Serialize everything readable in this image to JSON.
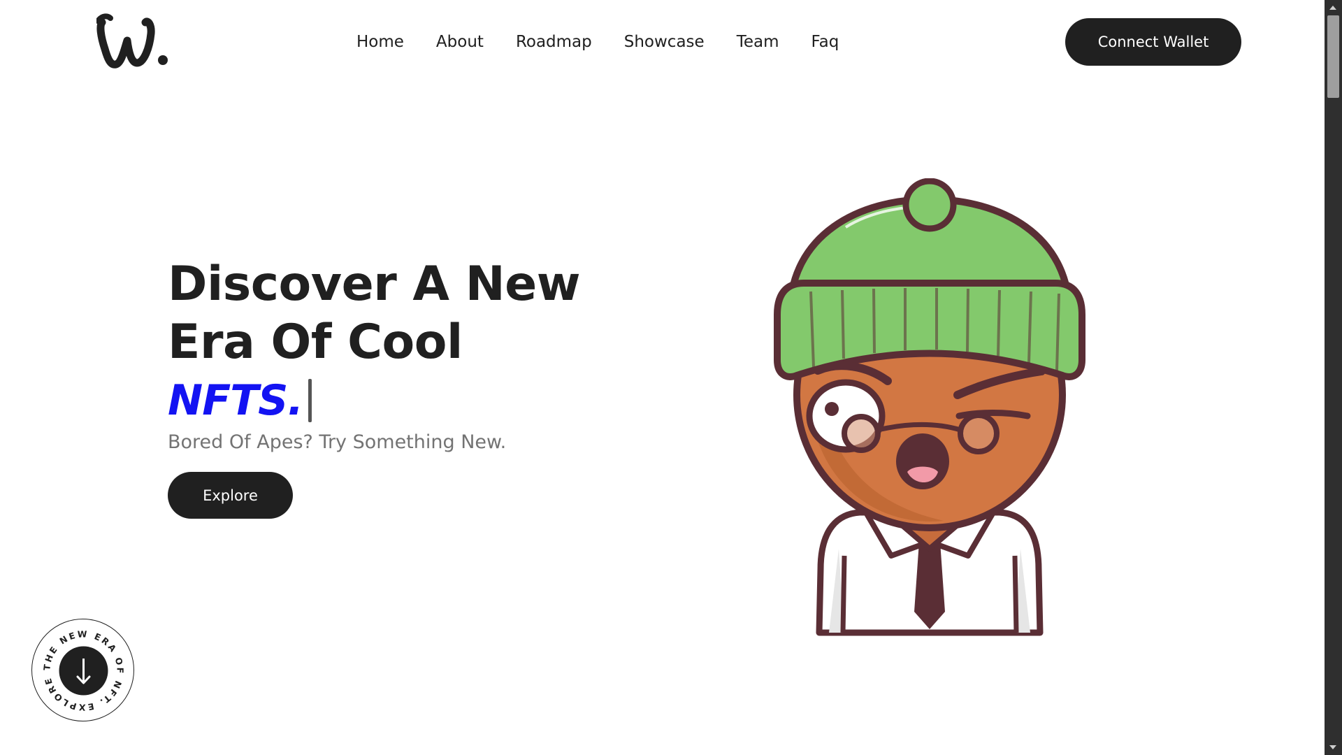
{
  "brand": {
    "logo_text": "W."
  },
  "nav": {
    "items": [
      {
        "label": "Home"
      },
      {
        "label": "About"
      },
      {
        "label": "Roadmap"
      },
      {
        "label": "Showcase"
      },
      {
        "label": "Team"
      },
      {
        "label": "Faq"
      }
    ],
    "connect_label": "Connect Wallet"
  },
  "hero": {
    "headline_line1": "Discover A New",
    "headline_line2": "Era Of Cool",
    "typed_word": "NFTS.",
    "subtitle": "Bored Of Apes? Try Something New.",
    "explore_label": "Explore"
  },
  "badge": {
    "circular_text": "THE NEW ERA OF NFT. EXPLORE ",
    "icon": "arrow-down-icon"
  },
  "colors": {
    "accent": "#1313f2",
    "dark": "#202020",
    "muted": "#737373",
    "hat_green": "#83c96c",
    "skin": "#d27743",
    "outline": "#5a2e35"
  }
}
